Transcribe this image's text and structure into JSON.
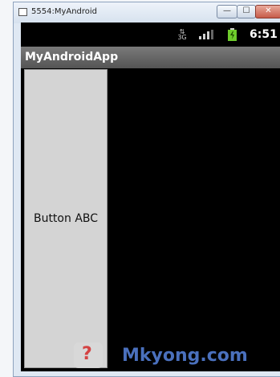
{
  "window": {
    "title": "5554:MyAndroid",
    "controls": {
      "minimize": "—",
      "maximize": "☐",
      "close": "✕"
    }
  },
  "status_bar": {
    "network": "3G",
    "time": "6:51"
  },
  "app": {
    "title": "MyAndroidApp",
    "button_label": "Button ABC"
  },
  "watermark": {
    "text": "Mkyong.com"
  },
  "colors": {
    "screen_bg": "#000000",
    "appbar_bg": "#6a6a6a",
    "button_bg": "#d4d4d4",
    "battery": "#6ecb2c",
    "watermark": "#4f77c8"
  }
}
